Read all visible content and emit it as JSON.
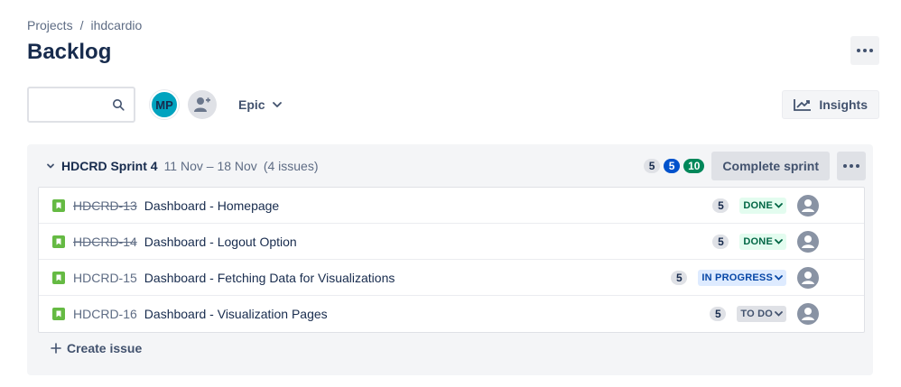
{
  "breadcrumb": {
    "projects": "Projects",
    "separator": "/",
    "project": "ihdcardio"
  },
  "page": {
    "title": "Backlog"
  },
  "toolbar": {
    "search_value": "",
    "avatar_initials": "MP",
    "epic_label": "Epic",
    "insights_label": "Insights"
  },
  "sprint": {
    "name": "HDCRD Sprint 4",
    "dates": "11 Nov – 18 Nov",
    "issue_count": "(4 issues)",
    "points_todo": "5",
    "points_in_progress": "5",
    "points_done": "10",
    "complete_label": "Complete sprint",
    "issues": [
      {
        "key": "HDCRD-13",
        "summary": "Dashboard - Homepage",
        "estimate": "5",
        "status": "DONE",
        "done": true
      },
      {
        "key": "HDCRD-14",
        "summary": "Dashboard - Logout Option",
        "estimate": "5",
        "status": "DONE",
        "done": true
      },
      {
        "key": "HDCRD-15",
        "summary": "Dashboard - Fetching Data for Visualizations",
        "estimate": "5",
        "status": "IN PROGRESS",
        "done": false
      },
      {
        "key": "HDCRD-16",
        "summary": "Dashboard - Visualization Pages",
        "estimate": "5",
        "status": "TO DO",
        "done": false
      }
    ],
    "create_issue_label": "Create issue"
  },
  "colors": {
    "accent": "#0052cc",
    "done_green": "#00875a",
    "story_green": "#65ba43",
    "avatar_teal": "#00a3bf"
  },
  "icons": [
    "search-icon",
    "add-people-icon",
    "chevron-down-icon",
    "insights-chart-icon",
    "more-icon",
    "story-icon",
    "user-avatar-icon",
    "plus-icon"
  ]
}
